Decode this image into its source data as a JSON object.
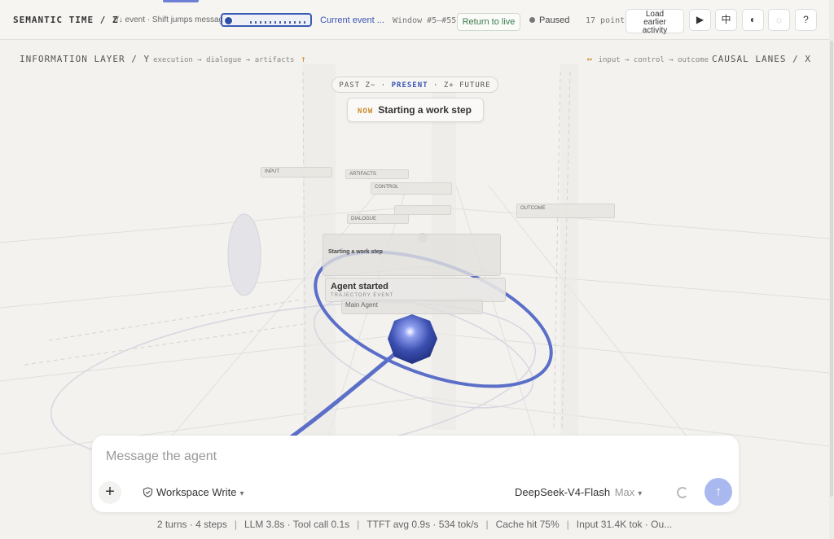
{
  "toolbar": {
    "title": "SEMANTIC TIME / Z",
    "hint": "↑/↓ event · Shift jumps messages",
    "current_event": "Current event ...",
    "window": "Window #5–#55",
    "return_live": "Return to live",
    "paused": "Paused",
    "points": "17 points",
    "load_earlier": [
      "Load",
      "earlier",
      "activity"
    ],
    "play_glyph": "▶",
    "lang_glyph": "中",
    "contrast_glyph": "◐",
    "sun_glyph": "☼",
    "help_glyph": "?"
  },
  "axes": {
    "info_layer": "INFORMATION LAYER / Y",
    "info_sub": "execution → dialogue → artifacts",
    "info_arrow": "↑",
    "causal": "CAUSAL LANES / X",
    "causal_sub": "input → control → outcome",
    "causal_arrow": "↔"
  },
  "timeline": {
    "past": "PAST Z−",
    "present": "PRESENT",
    "future": "Z+ FUTURE",
    "dot": "·"
  },
  "now_card": {
    "now": "NOW",
    "text": "Starting a work step"
  },
  "scene": {
    "lane_input": "INPUT",
    "lane_artifacts": "ARTIFACTS",
    "lane_control": "CONTROL",
    "lane_dialogue": "DIALOGUE",
    "lane_outcome": "OUTCOME",
    "card_step": "Starting a work step",
    "card_agent": "Agent started",
    "card_agent_sub": "TRAJECTORY EVENT",
    "card_main": "Main Agent"
  },
  "composer": {
    "placeholder": "Message the agent",
    "workspace": "Workspace Write",
    "model": "DeepSeek-V4-Flash",
    "effort": "Max",
    "send_glyph": "↑",
    "plus_glyph": "+"
  },
  "status": {
    "items": [
      "2 turns · 4 steps",
      "LLM 3.8s · Tool call 0.1s",
      "TTFT avg 0.9s · 534 tok/s",
      "Cache hit 75%",
      "Input 31.4K tok · Ou..."
    ],
    "separator": "|"
  },
  "colors": {
    "accent": "#3c55b3",
    "orb": "#3b4fb0",
    "orbit": "#5b6fc8"
  }
}
